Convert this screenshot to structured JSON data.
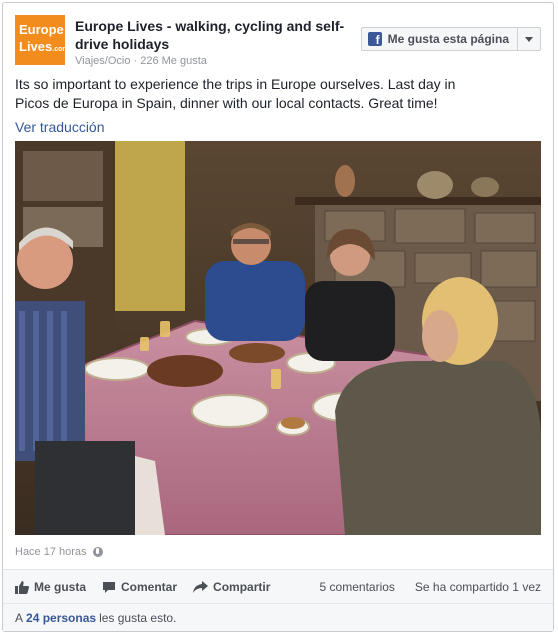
{
  "page": {
    "name": "Europe Lives - walking, cycling and self-drive holidays",
    "category": "Viajes/Ocio",
    "likes_count": "226 Me gusta",
    "separator": " · ",
    "logo": {
      "line1": "Europe",
      "line2": "Lives",
      "line2_suffix": ".com",
      "color": "#f28c1c"
    }
  },
  "like_page_button": {
    "label": "Me gusta esta página",
    "icon": "facebook-f-icon"
  },
  "post": {
    "text": "Its so important to experience the trips in Europe ourselves. Last day in Picos de Europa in Spain, dinner with our local contacts. Great time!",
    "translate_link": "Ver traducción",
    "timestamp": "Hace 17 horas",
    "privacy_icon": "globe-icon"
  },
  "actions": {
    "like": "Me gusta",
    "comment": "Comentar",
    "share": "Compartir",
    "comments_count": "5 comentarios",
    "shares_count": "Se ha compartido 1 vez"
  },
  "likes_summary": {
    "prefix": "A",
    "people": "24 personas",
    "suffix": "les gusta esto."
  },
  "colors": {
    "link": "#365899",
    "brand": "#3b5998",
    "muted": "#90949c"
  }
}
